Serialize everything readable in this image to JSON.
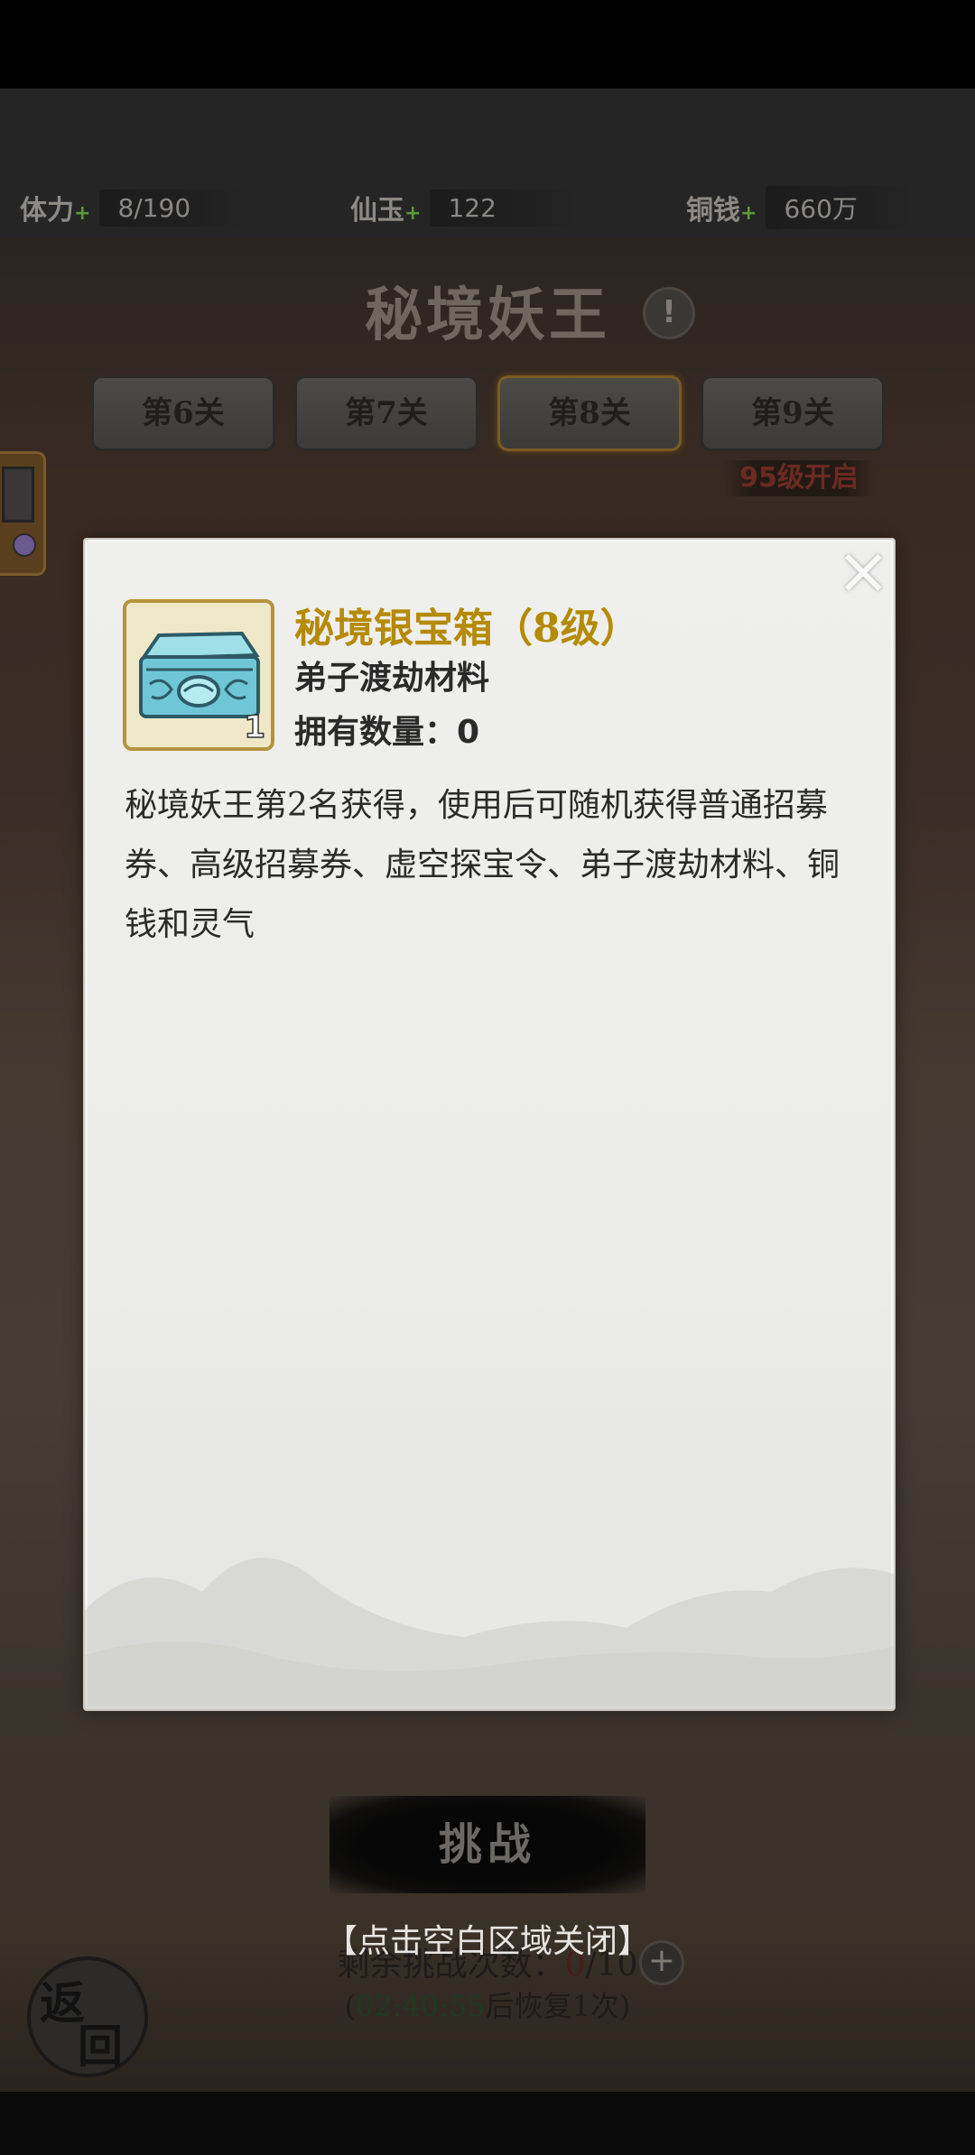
{
  "hud": {
    "stamina": {
      "label": "体力",
      "value": "8/190"
    },
    "jade": {
      "label": "仙玉",
      "value": "122"
    },
    "copper": {
      "label": "铜钱",
      "value": "660万"
    },
    "plus_icon": "plus-icon"
  },
  "event": {
    "title": "秘境妖王",
    "info_icon": "!"
  },
  "stages": {
    "tabs": [
      {
        "label": "第6关"
      },
      {
        "label": "第7关"
      },
      {
        "label": "第8关",
        "active": true
      },
      {
        "label": "第9关"
      }
    ],
    "lock_note": "95级开启"
  },
  "modal": {
    "item_name": "秘境银宝箱（8级）",
    "item_type": "弟子渡劫材料",
    "owned": "拥有数量：0",
    "icon_quantity": "1",
    "description": "秘境妖王第2名获得，使用后可随机获得普通招募券、高级招募券、虚空探宝令、弟子渡劫材料、铜钱和灵气",
    "close_icon": "×"
  },
  "close_hint": "【点击空白区域关闭】",
  "challenge": {
    "label": "挑战",
    "remaining_label": "剩余挑战次数：",
    "remaining_used": "0",
    "remaining_total": "/10",
    "recover_open": "(",
    "recover_time": "02:40:55",
    "recover_text": "后恢复1次)"
  },
  "back": {
    "char1": "返",
    "char2": "回"
  },
  "colors": {
    "gold": "#b58a06",
    "dim_red": "#6b2a22",
    "modal_bg": "#ececea"
  }
}
